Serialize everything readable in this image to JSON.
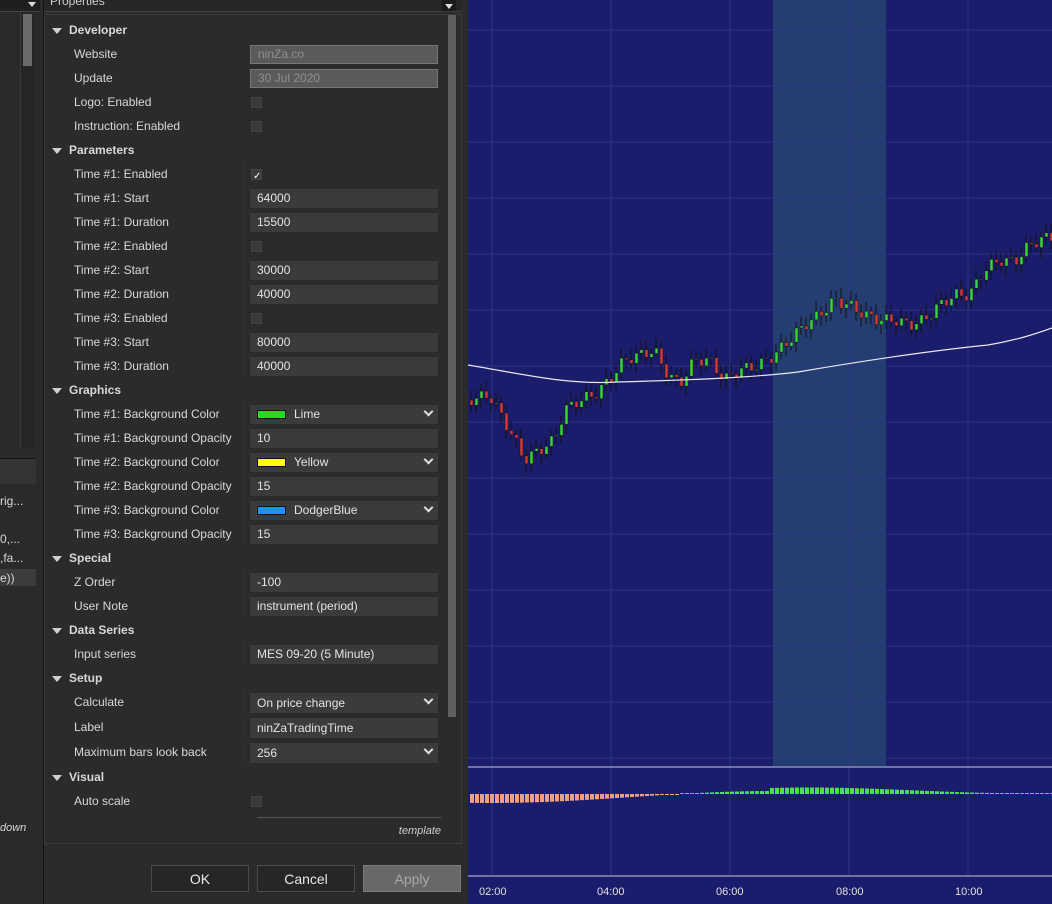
{
  "dialog": {
    "title": "Properties",
    "template_label": "template",
    "buttons": {
      "ok": "OK",
      "cancel": "Cancel",
      "apply": "Apply"
    }
  },
  "left_panel": {
    "fragments": [
      "rig...",
      "0,...",
      ",fa...",
      "e))",
      "down"
    ]
  },
  "categories": {
    "developer": "Developer",
    "parameters": "Parameters",
    "graphics": "Graphics",
    "special": "Special",
    "data_series": "Data Series",
    "setup": "Setup",
    "visual": "Visual"
  },
  "props": {
    "website": {
      "label": "Website",
      "value": "ninZa.co"
    },
    "update": {
      "label": "Update",
      "value": "30 Jul 2020"
    },
    "logo": {
      "label": "Logo: Enabled",
      "checked": false
    },
    "instruction": {
      "label": "Instruction: Enabled",
      "checked": false
    },
    "t1_enabled": {
      "label": "Time #1: Enabled",
      "checked": true
    },
    "t1_start": {
      "label": "Time #1: Start",
      "value": "64000"
    },
    "t1_duration": {
      "label": "Time #1: Duration",
      "value": "15500"
    },
    "t2_enabled": {
      "label": "Time #2: Enabled",
      "checked": false
    },
    "t2_start": {
      "label": "Time #2: Start",
      "value": "30000"
    },
    "t2_duration": {
      "label": "Time #2: Duration",
      "value": "40000"
    },
    "t3_enabled": {
      "label": "Time #3: Enabled",
      "checked": false
    },
    "t3_start": {
      "label": "Time #3: Start",
      "value": "80000"
    },
    "t3_duration": {
      "label": "Time #3: Duration",
      "value": "40000"
    },
    "t1_bg_color": {
      "label": "Time #1: Background Color",
      "value": "Lime",
      "color": "#22dd22"
    },
    "t1_bg_opacity": {
      "label": "Time #1: Background Opacity",
      "value": "10"
    },
    "t2_bg_color": {
      "label": "Time #2: Background Color",
      "value": "Yellow",
      "color": "#ffff00"
    },
    "t2_bg_opacity": {
      "label": "Time #2: Background Opacity",
      "value": "15"
    },
    "t3_bg_color": {
      "label": "Time #3: Background Color",
      "value": "DodgerBlue",
      "color": "#1e90ff"
    },
    "t3_bg_opacity": {
      "label": "Time #3: Background Opacity",
      "value": "15"
    },
    "z_order": {
      "label": "Z Order",
      "value": "-100"
    },
    "user_note": {
      "label": "User Note",
      "value": "instrument (period)"
    },
    "input_series": {
      "label": "Input series",
      "value": "MES 09-20 (5 Minute)"
    },
    "calculate": {
      "label": "Calculate",
      "value": "On price change"
    },
    "label": {
      "label": "Label",
      "value": "ninZaTradingTime"
    },
    "max_bars": {
      "label": "Maximum bars look back",
      "value": "256"
    },
    "auto_scale": {
      "label": "Auto scale",
      "checked": false
    }
  },
  "chart": {
    "background": "#1a1c6c",
    "highlight_color": "#243e72",
    "x_ticks": [
      "02:00",
      "04:00",
      "06:00",
      "08:00",
      "10:00"
    ]
  }
}
